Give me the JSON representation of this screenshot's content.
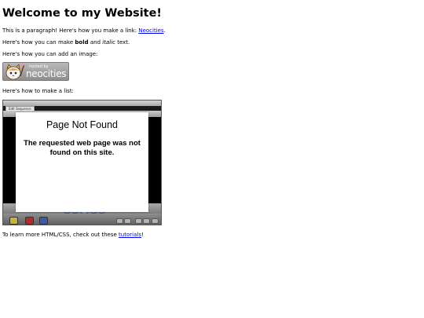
{
  "page": {
    "title": "Welcome to my Website!",
    "para_intro": "This is a paragraph! Here's how you make a link: ",
    "link_neocities": "Neocities",
    "para_intro_end": ".",
    "bold_pre": "Here's how you can make ",
    "bold_word": "bold",
    "bold_mid": " and ",
    "italic_word": "italic",
    "bold_end": " text.",
    "image_intro": "Here's how you can add an image:",
    "list_intro": "Here's how to make a list:",
    "learn_pre": "To learn more HTML/CSS, check out these ",
    "link_tutorials": "tutorials",
    "learn_end": "!"
  },
  "badge": {
    "small_text": "hosted by",
    "big_text": "neocities",
    "icon": "neocities-cat-icon"
  },
  "editor": {
    "tab_label": "Edit Sequence",
    "popup_title": "Page Not Found",
    "popup_message": "The requested web page was not found on this site."
  },
  "colors": {
    "link": "#0000ee",
    "badge_bg": "#a3a3a3",
    "cat_orange": "#e8a33a"
  }
}
